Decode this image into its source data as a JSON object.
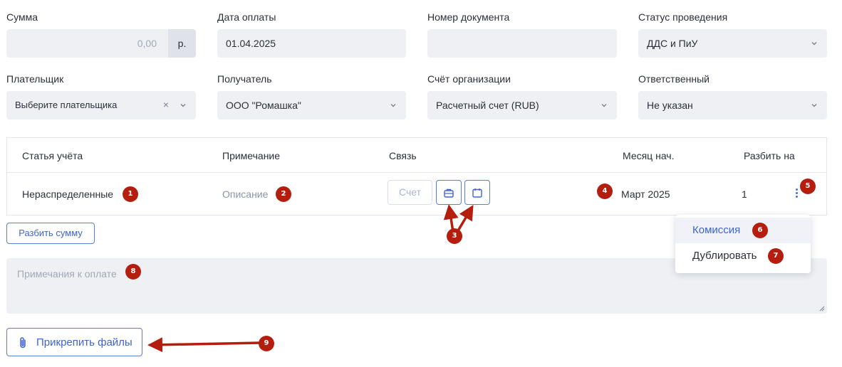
{
  "form": {
    "amount": {
      "label": "Сумма",
      "value": "0,00",
      "unit": "р."
    },
    "payment_date": {
      "label": "Дата оплаты",
      "value": "01.04.2025"
    },
    "document_number": {
      "label": "Номер документа",
      "value": ""
    },
    "posting_status": {
      "label": "Статус проведения",
      "value": "ДДС и ПиУ"
    },
    "payer": {
      "label": "Плательщик",
      "value": "Выберите плательщика",
      "clear": "×"
    },
    "recipient": {
      "label": "Получатель",
      "value": "ООО \"Ромашка\""
    },
    "org_account": {
      "label": "Счёт организации",
      "value": "Расчетный счет (RUB)"
    },
    "responsible": {
      "label": "Ответственный",
      "value": "Не указан"
    }
  },
  "table": {
    "headers": [
      "Статья учёта",
      "Примечание",
      "Связь",
      "Месяц нач.",
      "Разбить на"
    ],
    "row": {
      "article": "Нераспределенные",
      "note": "Описание",
      "invoice_button": "Счет",
      "month": "Март 2025",
      "split": "1"
    }
  },
  "split_button": "Разбить сумму",
  "notes_placeholder": "Примечания к оплате",
  "attach_button": "Прикрепить файлы",
  "context_menu": {
    "items": [
      "Комиссия",
      "Дублировать"
    ]
  },
  "annotations": {
    "badges": [
      "1",
      "2",
      "3",
      "4",
      "5",
      "6",
      "7",
      "8",
      "9"
    ],
    "color": "#b51d0f"
  },
  "colors": {
    "accent": "#3f63cf",
    "field_bg": "#eef0f4",
    "border": "#e3e6ec"
  }
}
